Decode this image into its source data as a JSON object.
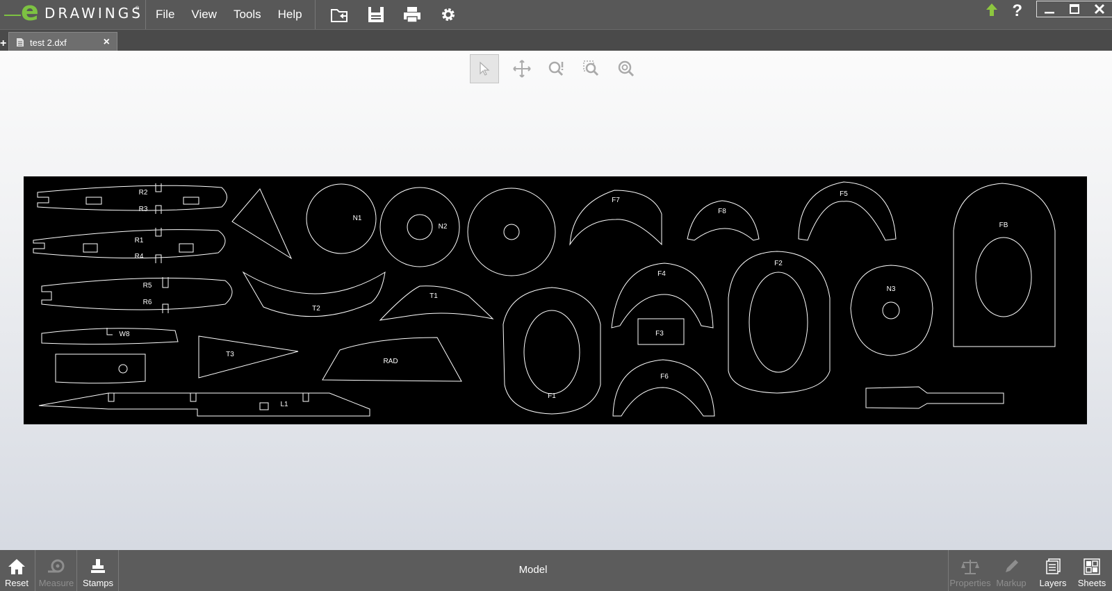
{
  "app": {
    "brand_e": "e",
    "brand_text": "DRAWINGS",
    "reg": "®"
  },
  "menu": {
    "items": [
      "File",
      "View",
      "Tools",
      "Help"
    ]
  },
  "toolbar": {
    "icons": [
      "open-file-icon",
      "save-icon",
      "print-icon",
      "gear-icon"
    ]
  },
  "window": {
    "help": "?"
  },
  "tabs": {
    "new_tab": "+",
    "active": {
      "title": "test 2.dxf",
      "close": "×"
    }
  },
  "view_tools": [
    "select-arrow-icon",
    "pan-icon",
    "zoom-dynamic-icon",
    "zoom-area-icon",
    "zoom-fit-icon"
  ],
  "drawing": {
    "background": "#000000",
    "stroke": "#ffffff",
    "labels": [
      "R2",
      "R3",
      "R1",
      "R4",
      "R5",
      "R6",
      "W8",
      "T3",
      "T2",
      "T1",
      "RAD",
      "F7",
      "F8",
      "F5",
      "F4",
      "F3",
      "F2",
      "F1",
      "F6",
      "N3",
      "FB",
      "L1",
      "N1",
      "N2"
    ]
  },
  "bottom": {
    "mode": "Model",
    "left": [
      {
        "label": "Reset",
        "enabled": true
      },
      {
        "label": "Measure",
        "enabled": false
      },
      {
        "label": "Stamps",
        "enabled": true
      }
    ],
    "right": [
      {
        "label": "Properties",
        "enabled": false
      },
      {
        "label": "Markup",
        "enabled": false
      },
      {
        "label": "Layers",
        "enabled": true
      },
      {
        "label": "Sheets",
        "enabled": true
      }
    ]
  },
  "colors": {
    "brand_green": "#7dc242",
    "bar_gray": "#585858"
  }
}
